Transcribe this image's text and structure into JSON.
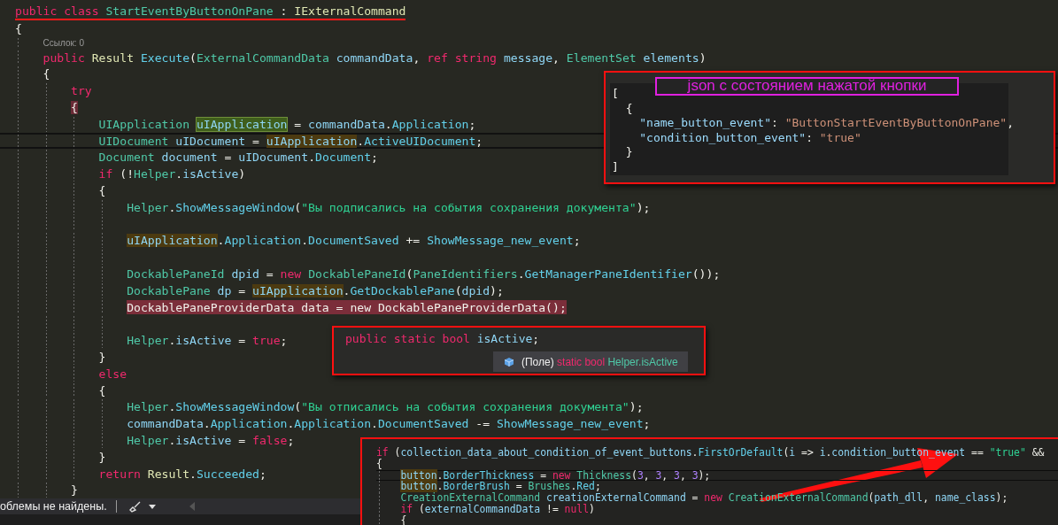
{
  "editor": {
    "lines": [
      {
        "kind": "code",
        "underlined": true,
        "tokens": [
          {
            "text": "public class ",
            "kind": "kw"
          },
          {
            "text": "StartEventByButtonOnPane",
            "kind": "type"
          },
          {
            "text": " : ",
            "kind": "p"
          },
          {
            "text": "IExternalCommand",
            "kind": "cls"
          }
        ]
      },
      {
        "kind": "code",
        "tokens": [
          {
            "text": "{",
            "kind": "p"
          }
        ],
        "children": [
          {
            "kind": "codelens",
            "text": "Ссылок: 0"
          },
          {
            "kind": "code",
            "tokens": [
              {
                "text": "public ",
                "kind": "kw"
              },
              {
                "text": "Result ",
                "kind": "cls"
              },
              {
                "text": "Execute",
                "kind": "fn"
              },
              {
                "text": "(",
                "kind": "p"
              },
              {
                "text": "ExternalCommandData",
                "kind": "type"
              },
              {
                "text": " commandData",
                "kind": "var"
              },
              {
                "text": ", ",
                "kind": "p"
              },
              {
                "text": "ref string",
                "kind": "kw"
              },
              {
                "text": " message",
                "kind": "var"
              },
              {
                "text": ", ",
                "kind": "p"
              },
              {
                "text": "ElementSet",
                "kind": "type"
              },
              {
                "text": " elements",
                "kind": "var"
              },
              {
                "text": ")",
                "kind": "p"
              }
            ]
          },
          {
            "kind": "code",
            "tokens": [
              {
                "text": "{",
                "kind": "p"
              }
            ],
            "children": [
              {
                "kind": "code",
                "tokens": [
                  {
                    "text": "try",
                    "kind": "kw"
                  }
                ]
              },
              {
                "kind": "code",
                "tokens": [
                  {
                    "text": "{",
                    "kind": "p",
                    "brace_match": true
                  }
                ],
                "children": [
                  {
                    "kind": "code",
                    "tokens": [
                      {
                        "text": "UIApplication ",
                        "kind": "type"
                      },
                      {
                        "text": "uIApplication",
                        "kind": "var",
                        "definition": true
                      },
                      {
                        "text": " = ",
                        "kind": "p"
                      },
                      {
                        "text": "commandData",
                        "kind": "var"
                      },
                      {
                        "text": ".",
                        "kind": "p"
                      },
                      {
                        "text": "Application",
                        "kind": "fn"
                      },
                      {
                        "text": ";",
                        "kind": "p"
                      }
                    ]
                  },
                  {
                    "kind": "code",
                    "current": true,
                    "tokens": [
                      {
                        "text": "UIDocument",
                        "kind": "type"
                      },
                      {
                        "text": " uIDocument",
                        "kind": "var"
                      },
                      {
                        "text": " = ",
                        "kind": "p"
                      },
                      {
                        "text": "uIApplication",
                        "kind": "var",
                        "reference": true
                      },
                      {
                        "text": ".",
                        "kind": "p"
                      },
                      {
                        "text": "ActiveUIDocument",
                        "kind": "fn"
                      },
                      {
                        "text": ";",
                        "kind": "p"
                      }
                    ]
                  },
                  {
                    "kind": "code",
                    "tokens": [
                      {
                        "text": "Document",
                        "kind": "type"
                      },
                      {
                        "text": " document",
                        "kind": "var"
                      },
                      {
                        "text": " = ",
                        "kind": "p"
                      },
                      {
                        "text": "uIDocument",
                        "kind": "var"
                      },
                      {
                        "text": ".",
                        "kind": "p"
                      },
                      {
                        "text": "Document",
                        "kind": "fn"
                      },
                      {
                        "text": ";",
                        "kind": "p"
                      }
                    ]
                  },
                  {
                    "kind": "code",
                    "tokens": [
                      {
                        "text": "if",
                        "kind": "kw"
                      },
                      {
                        "text": " (!",
                        "kind": "p"
                      },
                      {
                        "text": "Helper",
                        "kind": "type"
                      },
                      {
                        "text": ".",
                        "kind": "p"
                      },
                      {
                        "text": "isActive",
                        "kind": "var"
                      },
                      {
                        "text": ")",
                        "kind": "p"
                      }
                    ]
                  },
                  {
                    "kind": "code",
                    "tokens": [
                      {
                        "text": "{",
                        "kind": "p"
                      }
                    ],
                    "children": [
                      {
                        "kind": "code",
                        "tokens": [
                          {
                            "text": "Helper",
                            "kind": "type"
                          },
                          {
                            "text": ".",
                            "kind": "p"
                          },
                          {
                            "text": "ShowMessageWindow",
                            "kind": "fn"
                          },
                          {
                            "text": "(",
                            "kind": "p"
                          },
                          {
                            "text": "\"Вы подписались на события сохранения документа\"",
                            "kind": "str"
                          },
                          {
                            "text": ");",
                            "kind": "p"
                          }
                        ]
                      },
                      {
                        "kind": "blank"
                      },
                      {
                        "kind": "code",
                        "tokens": [
                          {
                            "text": "uIApplication",
                            "kind": "var",
                            "reference": true
                          },
                          {
                            "text": ".",
                            "kind": "p"
                          },
                          {
                            "text": "Application",
                            "kind": "fn"
                          },
                          {
                            "text": ".",
                            "kind": "p"
                          },
                          {
                            "text": "DocumentSaved",
                            "kind": "fn"
                          },
                          {
                            "text": " += ",
                            "kind": "p"
                          },
                          {
                            "text": "ShowMessage_new_event",
                            "kind": "fn"
                          },
                          {
                            "text": ";",
                            "kind": "p"
                          }
                        ]
                      },
                      {
                        "kind": "blank"
                      },
                      {
                        "kind": "code",
                        "tokens": [
                          {
                            "text": "DockablePaneId",
                            "kind": "type"
                          },
                          {
                            "text": " dpid",
                            "kind": "var"
                          },
                          {
                            "text": " = ",
                            "kind": "p"
                          },
                          {
                            "text": "new ",
                            "kind": "kw"
                          },
                          {
                            "text": "DockablePaneId",
                            "kind": "type"
                          },
                          {
                            "text": "(",
                            "kind": "p"
                          },
                          {
                            "text": "PaneIdentifiers",
                            "kind": "type"
                          },
                          {
                            "text": ".",
                            "kind": "p"
                          },
                          {
                            "text": "GetManagerPaneIdentifier",
                            "kind": "fn"
                          },
                          {
                            "text": "());",
                            "kind": "p"
                          }
                        ]
                      },
                      {
                        "kind": "code",
                        "tokens": [
                          {
                            "text": "DockablePane",
                            "kind": "type"
                          },
                          {
                            "text": " dp",
                            "kind": "var"
                          },
                          {
                            "text": " = ",
                            "kind": "p"
                          },
                          {
                            "text": "uIApplication",
                            "kind": "var",
                            "reference": true
                          },
                          {
                            "text": ".",
                            "kind": "p"
                          },
                          {
                            "text": "GetDockablePane",
                            "kind": "fn"
                          },
                          {
                            "text": "(",
                            "kind": "p"
                          },
                          {
                            "text": "dpid",
                            "kind": "var"
                          },
                          {
                            "text": ");",
                            "kind": "p"
                          }
                        ]
                      },
                      {
                        "kind": "code",
                        "breakpoint": true,
                        "tokens": [
                          {
                            "text": "DockablePaneProviderData data = new DockablePaneProviderData();",
                            "kind": "p"
                          }
                        ]
                      },
                      {
                        "kind": "blank"
                      },
                      {
                        "kind": "code",
                        "tokens": [
                          {
                            "text": "Helper",
                            "kind": "type"
                          },
                          {
                            "text": ".",
                            "kind": "p"
                          },
                          {
                            "text": "isActive",
                            "kind": "var"
                          },
                          {
                            "text": " = ",
                            "kind": "p"
                          },
                          {
                            "text": "true",
                            "kind": "kw"
                          },
                          {
                            "text": ";",
                            "kind": "p"
                          }
                        ]
                      }
                    ]
                  },
                  {
                    "kind": "code",
                    "tokens": [
                      {
                        "text": "}",
                        "kind": "p"
                      }
                    ]
                  },
                  {
                    "kind": "code",
                    "tokens": [
                      {
                        "text": "else",
                        "kind": "kw"
                      }
                    ]
                  },
                  {
                    "kind": "code",
                    "tokens": [
                      {
                        "text": "{",
                        "kind": "p"
                      }
                    ],
                    "children": [
                      {
                        "kind": "code",
                        "tokens": [
                          {
                            "text": "Helper",
                            "kind": "type"
                          },
                          {
                            "text": ".",
                            "kind": "p"
                          },
                          {
                            "text": "ShowMessageWindow",
                            "kind": "fn"
                          },
                          {
                            "text": "(",
                            "kind": "p"
                          },
                          {
                            "text": "\"Вы отписались на события сохранения документа\"",
                            "kind": "str"
                          },
                          {
                            "text": ");",
                            "kind": "p"
                          }
                        ]
                      },
                      {
                        "kind": "code",
                        "tokens": [
                          {
                            "text": "commandData",
                            "kind": "var"
                          },
                          {
                            "text": ".",
                            "kind": "p"
                          },
                          {
                            "text": "Application",
                            "kind": "fn"
                          },
                          {
                            "text": ".",
                            "kind": "p"
                          },
                          {
                            "text": "Application",
                            "kind": "fn"
                          },
                          {
                            "text": ".",
                            "kind": "p"
                          },
                          {
                            "text": "DocumentSaved",
                            "kind": "fn"
                          },
                          {
                            "text": " -= ",
                            "kind": "p"
                          },
                          {
                            "text": "ShowMessage_new_event",
                            "kind": "fn"
                          },
                          {
                            "text": ";",
                            "kind": "p"
                          }
                        ]
                      },
                      {
                        "kind": "code",
                        "tokens": [
                          {
                            "text": "Helper",
                            "kind": "type"
                          },
                          {
                            "text": ".",
                            "kind": "p"
                          },
                          {
                            "text": "isActive",
                            "kind": "var"
                          },
                          {
                            "text": " = ",
                            "kind": "p"
                          },
                          {
                            "text": "false",
                            "kind": "kw"
                          },
                          {
                            "text": ";",
                            "kind": "p"
                          }
                        ]
                      }
                    ]
                  },
                  {
                    "kind": "code",
                    "tokens": [
                      {
                        "text": "}",
                        "kind": "p"
                      }
                    ]
                  },
                  {
                    "kind": "code",
                    "tokens": [
                      {
                        "text": "return ",
                        "kind": "kw"
                      },
                      {
                        "text": "Result",
                        "kind": "cls"
                      },
                      {
                        "text": ".",
                        "kind": "p"
                      },
                      {
                        "text": "Succeeded",
                        "kind": "fn"
                      },
                      {
                        "text": ";",
                        "kind": "p"
                      }
                    ]
                  }
                ]
              },
              {
                "kind": "code",
                "tokens": [
                  {
                    "text": "}",
                    "kind": "p"
                  }
                ]
              }
            ]
          }
        ]
      }
    ]
  },
  "json_preview": {
    "title": "json с состоянием нажатой кнопки",
    "lines": [
      {
        "tokens": [
          {
            "text": "[",
            "kind": "p"
          }
        ],
        "children": [
          {
            "tokens": [
              {
                "text": "{",
                "kind": "p"
              }
            ],
            "children": [
              {
                "tokens": [
                  {
                    "text": "\"name_button_event\"",
                    "kind": "key"
                  },
                  {
                    "text": ": ",
                    "kind": "p"
                  },
                  {
                    "text": "\"ButtonStartEventByButtonOnPane\"",
                    "kind": "jstr"
                  },
                  {
                    "text": ",",
                    "kind": "p"
                  }
                ]
              },
              {
                "tokens": [
                  {
                    "text": "\"condition_button_event\"",
                    "kind": "key"
                  },
                  {
                    "text": ": ",
                    "kind": "p"
                  },
                  {
                    "text": "\"true\"",
                    "kind": "jstr"
                  }
                ]
              }
            ]
          },
          {
            "tokens": [
              {
                "text": "}",
                "kind": "p"
              }
            ]
          }
        ]
      },
      {
        "tokens": [
          {
            "text": "]",
            "kind": "p"
          }
        ]
      }
    ]
  },
  "peek": {
    "tokens": [
      {
        "text": "public static bool",
        "kind": "kw"
      },
      {
        "text": " isActive",
        "kind": "var"
      },
      {
        "text": ";",
        "kind": "p"
      }
    ],
    "tooltip": {
      "tokens": [
        {
          "text": "(Поле) ",
          "kind": "p"
        },
        {
          "text": "static bool ",
          "kind": "kw"
        },
        {
          "text": "Helper.isActive",
          "kind": "type"
        }
      ]
    }
  },
  "code_excerpt": {
    "lines": [
      {
        "tokens": [
          {
            "text": "if",
            "kind": "kw"
          },
          {
            "text": " (",
            "kind": "p"
          },
          {
            "text": "collection_data_about_condition_of_event_buttons",
            "kind": "var"
          },
          {
            "text": ".",
            "kind": "p"
          },
          {
            "text": "FirstOrDefault",
            "kind": "fn"
          },
          {
            "text": "(",
            "kind": "p"
          },
          {
            "text": "i",
            "kind": "var"
          },
          {
            "text": " => ",
            "kind": "p"
          },
          {
            "text": "i",
            "kind": "var"
          },
          {
            "text": ".",
            "kind": "p"
          },
          {
            "text": "condition_button_event",
            "kind": "var"
          },
          {
            "text": " == ",
            "kind": "p"
          },
          {
            "text": "\"true\"",
            "kind": "str"
          },
          {
            "text": " &&",
            "kind": "p"
          }
        ]
      },
      {
        "tokens": [
          {
            "text": "{",
            "kind": "p"
          }
        ],
        "children": [
          {
            "current": true,
            "tokens": [
              {
                "text": "button",
                "kind": "var",
                "reference": true
              },
              {
                "text": ".",
                "kind": "p"
              },
              {
                "text": "BorderThickness",
                "kind": "fn"
              },
              {
                "text": " = ",
                "kind": "p"
              },
              {
                "text": "new ",
                "kind": "kw"
              },
              {
                "text": "Thickness",
                "kind": "type"
              },
              {
                "text": "(",
                "kind": "p"
              },
              {
                "text": "3",
                "kind": "num"
              },
              {
                "text": ", ",
                "kind": "p"
              },
              {
                "text": "3",
                "kind": "num"
              },
              {
                "text": ", ",
                "kind": "p"
              },
              {
                "text": "3",
                "kind": "num"
              },
              {
                "text": ", ",
                "kind": "p"
              },
              {
                "text": "3",
                "kind": "num"
              },
              {
                "text": ");",
                "kind": "p"
              }
            ]
          },
          {
            "tokens": [
              {
                "text": "button",
                "kind": "var",
                "reference": true
              },
              {
                "text": ".",
                "kind": "p"
              },
              {
                "text": "BorderBrush",
                "kind": "fn"
              },
              {
                "text": " = ",
                "kind": "p"
              },
              {
                "text": "Brushes",
                "kind": "type"
              },
              {
                "text": ".",
                "kind": "p"
              },
              {
                "text": "Red",
                "kind": "fn"
              },
              {
                "text": ";",
                "kind": "p"
              }
            ]
          },
          {
            "tokens": [
              {
                "text": "CreationExternalCommand",
                "kind": "type"
              },
              {
                "text": " creationExternalCommand",
                "kind": "var"
              },
              {
                "text": " = ",
                "kind": "p"
              },
              {
                "text": "new ",
                "kind": "kw"
              },
              {
                "text": "CreationExternalCommand",
                "kind": "type"
              },
              {
                "text": "(",
                "kind": "p"
              },
              {
                "text": "path_dll",
                "kind": "var"
              },
              {
                "text": ", ",
                "kind": "p"
              },
              {
                "text": "name_class",
                "kind": "var"
              },
              {
                "text": ");",
                "kind": "p"
              }
            ]
          },
          {
            "tokens": [
              {
                "text": "if",
                "kind": "kw"
              },
              {
                "text": " (",
                "kind": "p"
              },
              {
                "text": "externalCommandData",
                "kind": "var"
              },
              {
                "text": " != ",
                "kind": "p"
              },
              {
                "text": "null",
                "kind": "kw"
              },
              {
                "text": ")",
                "kind": "p"
              }
            ]
          },
          {
            "tokens": [
              {
                "text": "{",
                "kind": "p"
              }
            ]
          }
        ]
      }
    ]
  },
  "status_bar": {
    "message": "облемы не найдены."
  }
}
